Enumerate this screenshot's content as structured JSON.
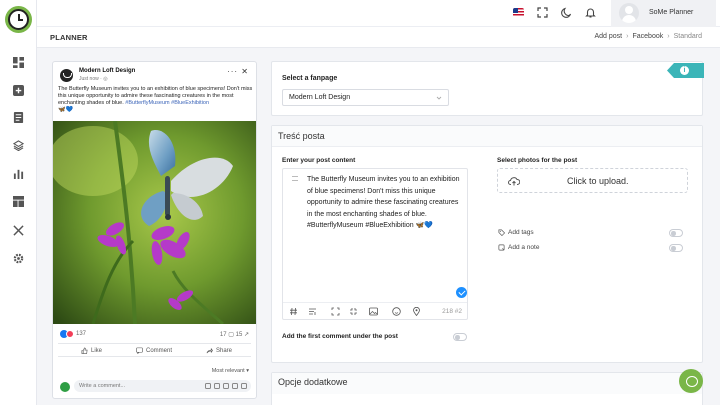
{
  "app": {
    "user_name": "SoMe Planner",
    "page_title": "PLANNER",
    "breadcrumbs": [
      "Add post",
      "Facebook",
      "Standard"
    ]
  },
  "sidebar": {
    "items": [
      {
        "icon": "dashboard-icon"
      },
      {
        "icon": "add-square-icon"
      },
      {
        "icon": "document-icon"
      },
      {
        "icon": "layers-icon"
      },
      {
        "icon": "bar-chart-icon"
      },
      {
        "icon": "layout-icon"
      },
      {
        "icon": "tools-icon"
      },
      {
        "icon": "settings-icon"
      }
    ]
  },
  "preview": {
    "page_name": "Modern Loft Design",
    "time": "Just now · ",
    "text_plain": "The Butterfly Museum invites you to an exhibition of blue specimens! Don't miss this unique opportunity to admire these fascinating creatures in the most enchanting shades of blue. ",
    "hashtags": "#ButterflyMuseum #BlueExhibition",
    "emoji": "🦋💙",
    "reactions_count": "137",
    "shares_count": "17",
    "comments_count": "15",
    "like_label": "Like",
    "comment_label": "Comment",
    "share_label": "Share",
    "most_relevant": "Most relevant ▾",
    "comment_placeholder": "Write a comment..."
  },
  "fanpage": {
    "label": "Select a fanpage",
    "selected": "Modern Loft Design"
  },
  "post_content": {
    "section_title": "Treść posta",
    "label": "Enter your post content",
    "text": "The Butterfly Museum invites you to an exhibition of blue specimens! Don't miss this unique opportunity to admire these fascinating creatures in the most enchanting shades of blue. #ButterflyMuseum #BlueExhibition 🦋💙",
    "counter": "218 #2",
    "first_comment_label": "Add the first comment under the post"
  },
  "photos": {
    "label": "Select photos for the post",
    "upload_text": "Click to upload.",
    "add_tags": "Add tags",
    "add_note": "Add a note"
  },
  "extra": {
    "section_title": "Opcje dodatkowe"
  },
  "colors": {
    "accent_teal": "#3bb5b8",
    "brand_green": "#7ab648",
    "link_blue": "#3b64b8"
  }
}
